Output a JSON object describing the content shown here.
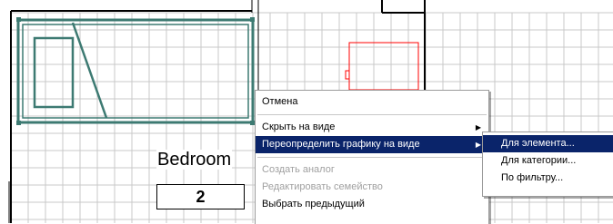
{
  "drawing": {
    "room_name": "Bedroom",
    "room_number": "2",
    "colors": {
      "grid": "#c8c8c8",
      "wall": "#000000",
      "selected_element": "#3d7a72",
      "highlighted_element": "#ff0000"
    }
  },
  "context_menu": {
    "items": [
      {
        "label": "Отмена",
        "disabled": false,
        "submenu": false
      },
      {
        "label": "Скрыть на виде",
        "disabled": false,
        "submenu": true
      },
      {
        "label": "Переопределить графику на виде",
        "disabled": false,
        "submenu": true,
        "highlighted": true
      },
      {
        "label": "Создать аналог",
        "disabled": true,
        "submenu": false
      },
      {
        "label": "Редактировать семейство",
        "disabled": true,
        "submenu": false
      },
      {
        "label": "Выбрать предыдущий",
        "disabled": false,
        "submenu": false
      }
    ],
    "arrow_glyph": "▶"
  },
  "submenu": {
    "items": [
      {
        "label": "Для элемента...",
        "highlighted": true
      },
      {
        "label": "Для категории..."
      },
      {
        "label": "По фильтру..."
      }
    ]
  }
}
